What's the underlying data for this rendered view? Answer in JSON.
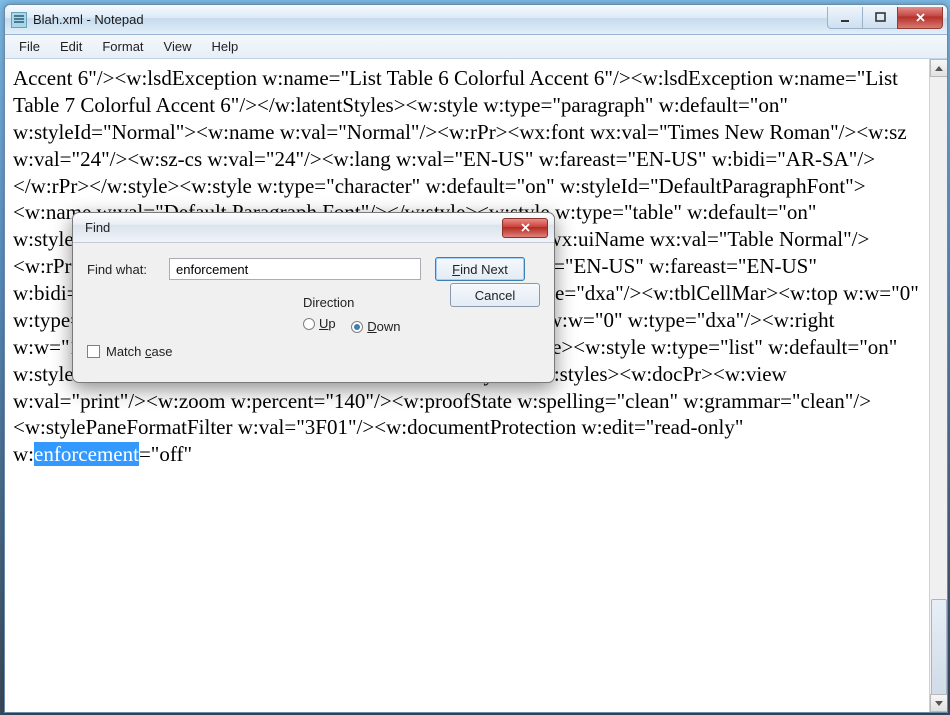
{
  "titlebar": {
    "title": "Blah.xml - Notepad"
  },
  "menu": {
    "file": "File",
    "edit": "Edit",
    "format": "Format",
    "view": "View",
    "help": "Help"
  },
  "content": {
    "pre": "Accent 6\"/><w:lsdException w:name=\"List Table 6 Colorful Accent 6\"/><w:lsdException w:name=\"List Table 7 Colorful Accent 6\"/></w:latentStyles><w:style w:type=\"paragraph\" w:default=\"on\" w:styleId=\"Normal\"><w:name w:val=\"Normal\"/><w:rPr><wx:font wx:val=\"Times New Roman\"/><w:sz w:val=\"24\"/><w:sz-cs w:val=\"24\"/><w:lang w:val=\"EN-US\" w:fareast=\"EN-US\" w:bidi=\"AR-SA\"/></w:rPr></w:style><w:style w:type=\"character\" w:default=\"on\" w:styleId=\"DefaultParagraphFont\"><w:name w:val=\"Default Paragraph Font\"/></w:style><w:style w:type=\"table\" w:default=\"on\" w:styleId=\"TableNormal\"><w:name w:val=\"Normal Table\"/><wx:uiName wx:val=\"Table Normal\"/><w:rPr><wx:font wx:val=\"Times New Roman\"/><w:lang w:val=\"EN-US\" w:fareast=\"EN-US\" w:bidi=\"AR-SA\"/></w:rPr><w:tblPr><w:tblInd w:w=\"0\" w:type=\"dxa\"/><w:tblCellMar><w:top w:w=\"0\" w:type=\"dxa\"/><w:left w:w=\"108\" w:type=\"dxa\"/><w:bottom w:w=\"0\" w:type=\"dxa\"/><w:right w:w=\"108\" w:type=\"dxa\"/></w:tblCellMar></w:tblPr></w:style><w:style w:type=\"list\" w:default=\"on\" w:styleId=\"NoList\"><w:name w:val=\"No List\"/></w:style></w:styles><w:docPr><w:view w:val=\"print\"/><w:zoom w:percent=\"140\"/><w:proofState w:spelling=\"clean\" w:grammar=\"clean\"/><w:stylePaneFormatFilter w:val=\"3F01\"/><w:documentProtection w:edit=\"read-only\" w:",
    "highlight": "enforcement",
    "post": "=\"off\""
  },
  "dialog": {
    "title": "Find",
    "find_what_label": "Find what:",
    "find_what_value": "enforcement",
    "find_next": "Find Next",
    "cancel": "Cancel",
    "direction_label": "Direction",
    "up": "Up",
    "down": "Down",
    "down_selected": true,
    "match_case": "Match case",
    "match_case_checked": false,
    "u_char": "U",
    "d_char": "D",
    "c_char": "c",
    "fn_char": "F"
  }
}
